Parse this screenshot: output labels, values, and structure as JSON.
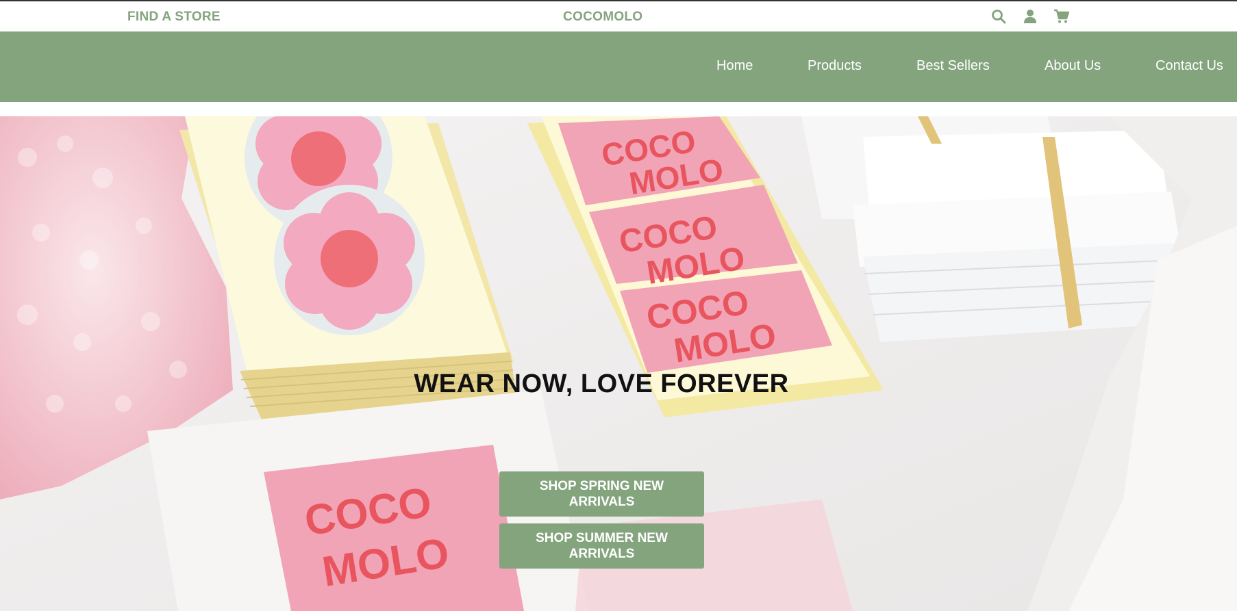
{
  "header": {
    "find_store": "FIND A STORE",
    "brand": "COCOMOLO",
    "icons": [
      "search-icon",
      "user-icon",
      "cart-icon"
    ]
  },
  "nav": {
    "items": [
      "Home",
      "Products",
      "Best Sellers",
      "About Us",
      "Contact Us"
    ]
  },
  "hero": {
    "headline": "WEAR NOW, LOVE FOREVER",
    "buttons": [
      "SHOP SPRING NEW ARRIVALS",
      "SHOP SUMMER NEW ARRIVALS"
    ],
    "image_text": [
      "COCO",
      "MOLO"
    ]
  },
  "colors": {
    "accent": "#84a47e",
    "nav_text": "#ffffff",
    "headline": "#111111",
    "sticker_pink": "#f4a9bb",
    "sticker_red": "#e8555f"
  }
}
